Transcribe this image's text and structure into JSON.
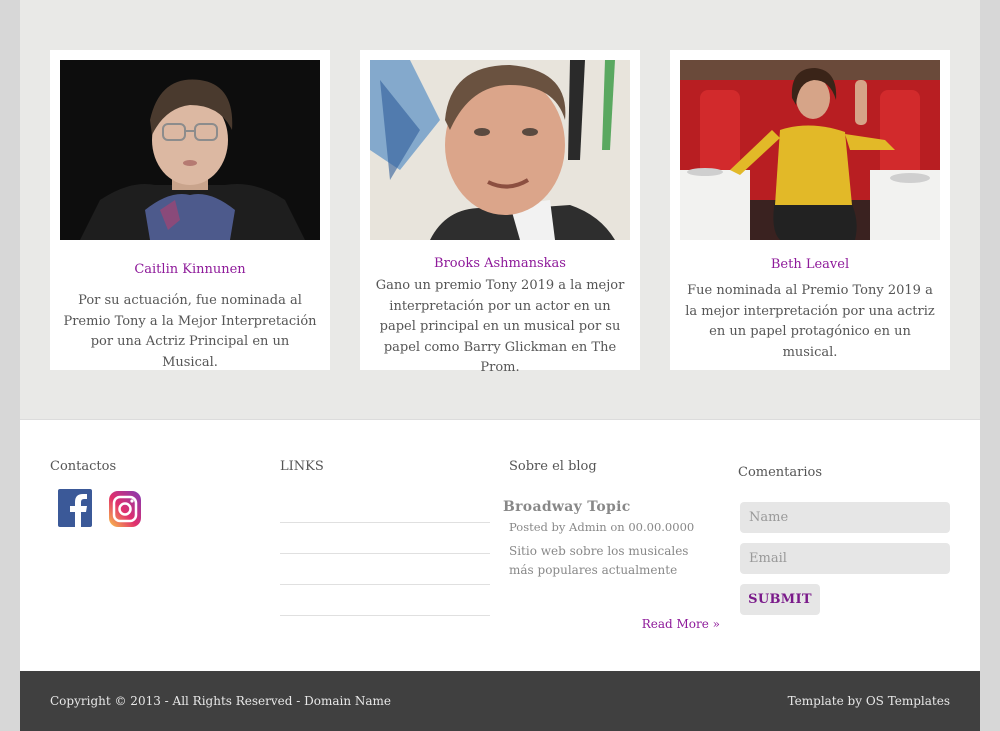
{
  "cards": [
    {
      "name": "Caitlin Kinnunen",
      "description": "Por su actuación, fue nominada al Premio Tony a la Mejor Interpretación por una Actriz Principal en un Musical."
    },
    {
      "name": "Brooks Ashmanskas",
      "description": "Gano un premio Tony 2019 a la mejor interpretación por un actor en un papel principal en un musical por su papel como Barry Glickman en The Prom."
    },
    {
      "name": "Beth Leavel",
      "description": "Fue nominada al Premio Tony 2019 a la mejor interpretación por una actriz en un papel protagónico en un musical."
    }
  ],
  "footer": {
    "contacts_title": "Contactos",
    "links_title": "LINKS",
    "blog": {
      "section_title": "Sobre el blog",
      "post_title": "Broadway Topic",
      "meta": "Posted by Admin on 00.00.0000",
      "text": "Sitio web sobre los musicales más populares actualmente",
      "read_more": "Read More »"
    },
    "comments": {
      "title": "Comentarios",
      "name_placeholder": "Name",
      "email_placeholder": "Email",
      "submit_label": "SUBMIT"
    },
    "copyright": "Copyright © 2013 - All Rights Reserved - Domain Name",
    "credit": "Template by OS Templates"
  },
  "colors": {
    "accent": "#8e1a9a",
    "band": "#e9e9e7",
    "bottom_bar": "#404040"
  },
  "icons": [
    "facebook-icon",
    "instagram-icon"
  ]
}
